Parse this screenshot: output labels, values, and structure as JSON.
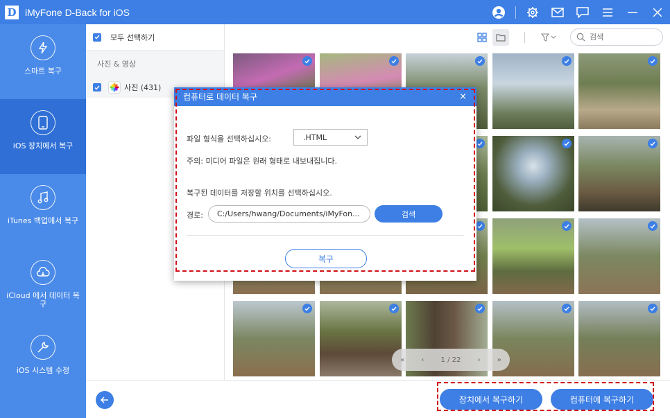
{
  "app": {
    "logo_letter": "D",
    "title": "iMyFone D-Back for iOS"
  },
  "titlebar_icons": [
    "account-icon",
    "settings-icon",
    "mail-icon",
    "feedback-icon",
    "menu-icon",
    "minimize-icon",
    "close-icon"
  ],
  "sidebar": {
    "items": [
      {
        "label": "스마트 복구",
        "icon": "smart-recovery-icon",
        "active": false
      },
      {
        "label": "iOS 장치에서 복구",
        "icon": "ios-device-icon",
        "active": true
      },
      {
        "label": "iTunes 백업에서 복구",
        "icon": "itunes-icon",
        "active": false
      },
      {
        "label": "iCloud 에서 데이터 복구",
        "icon": "icloud-icon",
        "active": false
      },
      {
        "label": "iOS 시스템 수정",
        "icon": "repair-icon",
        "active": false
      }
    ]
  },
  "listpanel": {
    "select_all_label": "모두 선택하기",
    "category": "사진 & 영상",
    "photos_label": "사진 (431)"
  },
  "toolbar": {
    "search_placeholder": "검색"
  },
  "pager": {
    "first": "«",
    "prev": "‹",
    "page": "1 / 22",
    "next": "›",
    "last": "»"
  },
  "footer": {
    "recover_device_label": "장치에서 복구하기",
    "recover_computer_label": "컴퓨터에 복구하기"
  },
  "dialog": {
    "title": "컴퓨터로 데이터 복구",
    "close": "×",
    "format_prompt": "파일 형식을 선택하십시오:",
    "format_value": ".HTML",
    "note": "주의: 미디어 파일은 원래 형태로 내보내집니다.",
    "location_prompt": "복구된 데이터를 저장할 위치를 선택하십시오.",
    "path_label": "경로:",
    "path_value": "C:/Users/hwang/Documents/iMyFon...",
    "browse_label": "검색",
    "recover_label": "복구"
  },
  "colors": {
    "accent": "#3d7fe4",
    "sidebar": "#4a8ae8",
    "sidebar_active": "#2f6fd6",
    "highlight": "#d0101a"
  }
}
